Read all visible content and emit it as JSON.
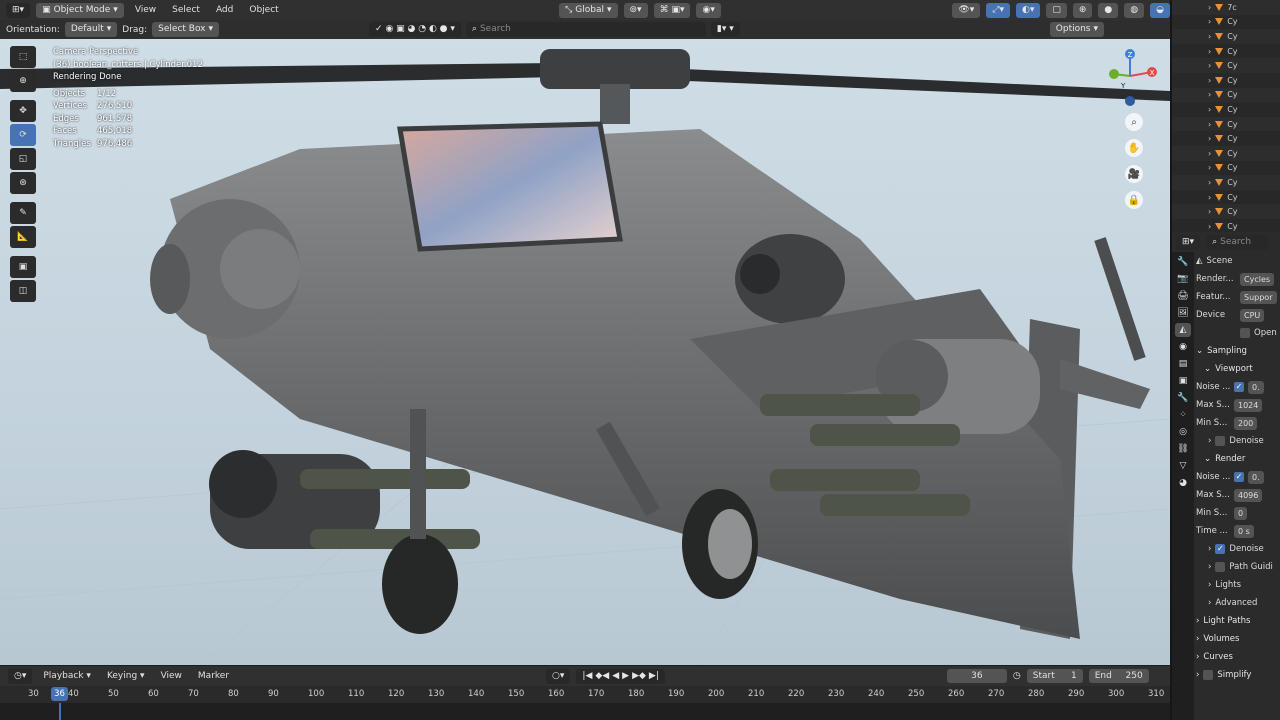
{
  "header": {
    "mode": "Object Mode",
    "menus": [
      "View",
      "Select",
      "Add",
      "Object"
    ],
    "orientation_global": "Global"
  },
  "subheader": {
    "orientation_label": "Orientation:",
    "orientation_value": "Default",
    "drag_label": "Drag:",
    "drag_value": "Select Box",
    "search_placeholder": "Search",
    "options_label": "Options"
  },
  "viewport": {
    "camera": "Camera Perspective",
    "object_info": "(36) boolean_cutters | Cylinder.012",
    "status": "Rendering Done",
    "stats": [
      {
        "label": "Objects",
        "value": "1/12"
      },
      {
        "label": "Vertices",
        "value": "276,510"
      },
      {
        "label": "Edges",
        "value": "961,578"
      },
      {
        "label": "Faces",
        "value": "465,018"
      },
      {
        "label": "Triangles",
        "value": "976,486"
      }
    ],
    "gizmo_axes": {
      "x": "X",
      "y": "Y",
      "z": "Z"
    }
  },
  "timeline": {
    "menus": [
      "Playback",
      "Keying",
      "View",
      "Marker"
    ],
    "current_frame": "36",
    "start_label": "Start",
    "start_value": "1",
    "end_label": "End",
    "end_value": "250",
    "ticks": [
      "30",
      "40",
      "50",
      "60",
      "70",
      "80",
      "90",
      "100",
      "110",
      "120",
      "130",
      "140",
      "150",
      "160",
      "170",
      "180",
      "190",
      "200",
      "210",
      "220",
      "230",
      "240",
      "250",
      "260",
      "270",
      "280",
      "290",
      "300",
      "310"
    ]
  },
  "outliner": {
    "items": [
      "7c",
      "Cy",
      "Cy",
      "Cy",
      "Cy",
      "Cy",
      "Cy",
      "Cy",
      "Cy",
      "Cy",
      "Cy",
      "Cy",
      "Cy",
      "Cy",
      "Cy",
      "Cy"
    ]
  },
  "properties": {
    "search_placeholder": "Search",
    "scene_label": "Scene",
    "render_engine_label": "Render...",
    "render_engine_value": "Cycles",
    "feature_label": "Featur...",
    "feature_value": "Suppor",
    "device_label": "Device",
    "device_value": "CPU",
    "open_label": "Open",
    "sampling": "Sampling",
    "viewport": "Viewport",
    "noise_label": "Noise ...",
    "noise_value": "0.",
    "max_samples_label": "Max S...",
    "viewport_max": "1024",
    "min_samples_label": "Min S...",
    "viewport_min": "200",
    "denoise": "Denoise",
    "render": "Render",
    "render_noise_value": "0.",
    "render_max": "4096",
    "render_min": "0",
    "time_label": "Time ...",
    "time_value": "0 s",
    "denoise2": "Denoise",
    "path_guiding": "Path Guidi",
    "lights": "Lights",
    "advanced": "Advanced",
    "light_paths": "Light Paths",
    "volumes": "Volumes",
    "curves": "Curves",
    "simplify": "Simplify"
  },
  "colors": {
    "accent": "#4772b3",
    "object_tri": "#e8903a",
    "sky": "#c9d8e1"
  }
}
